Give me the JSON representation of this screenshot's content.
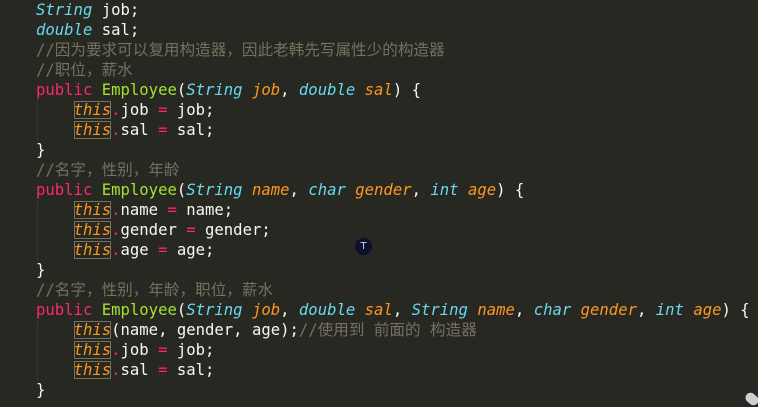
{
  "colors": {
    "background": "#282823",
    "keyword": "#f92672",
    "type": "#66d9ef",
    "function": "#a6e22e",
    "parameter": "#fd971f",
    "comment": "#75715e",
    "text": "#f8f8f2"
  },
  "lines": [
    [
      [
        "type",
        "String"
      ],
      [
        "plain",
        " job;"
      ]
    ],
    [
      [
        "type",
        "double"
      ],
      [
        "plain",
        " sal;"
      ]
    ],
    [
      [
        "comment",
        "//因为要求可以复用构造器，因此老韩先写属性少的构造器"
      ]
    ],
    [
      [
        "comment",
        "//职位，薪水"
      ]
    ],
    [
      [
        "kw",
        "public"
      ],
      [
        "plain",
        " "
      ],
      [
        "fn",
        "Employee"
      ],
      [
        "plain",
        "("
      ],
      [
        "type",
        "String"
      ],
      [
        "plain",
        " "
      ],
      [
        "param",
        "job"
      ],
      [
        "plain",
        ", "
      ],
      [
        "type",
        "double"
      ],
      [
        "plain",
        " "
      ],
      [
        "param",
        "sal"
      ],
      [
        "plain",
        ") {"
      ]
    ],
    [
      [
        "plain",
        "    "
      ],
      [
        "this",
        "this"
      ],
      [
        "op",
        "."
      ],
      [
        "plain",
        "job "
      ],
      [
        "op",
        "="
      ],
      [
        "plain",
        " job;"
      ]
    ],
    [
      [
        "plain",
        "    "
      ],
      [
        "this",
        "this"
      ],
      [
        "op",
        "."
      ],
      [
        "plain",
        "sal "
      ],
      [
        "op",
        "="
      ],
      [
        "plain",
        " sal;"
      ]
    ],
    [
      [
        "plain",
        "}"
      ]
    ],
    [
      [
        "comment",
        "//名字，性别，年龄"
      ]
    ],
    [
      [
        "kw",
        "public"
      ],
      [
        "plain",
        " "
      ],
      [
        "fn",
        "Employee"
      ],
      [
        "plain",
        "("
      ],
      [
        "type",
        "String"
      ],
      [
        "plain",
        " "
      ],
      [
        "param",
        "name"
      ],
      [
        "plain",
        ", "
      ],
      [
        "type",
        "char"
      ],
      [
        "plain",
        " "
      ],
      [
        "param",
        "gender"
      ],
      [
        "plain",
        ", "
      ],
      [
        "type",
        "int"
      ],
      [
        "plain",
        " "
      ],
      [
        "param",
        "age"
      ],
      [
        "plain",
        ") {"
      ]
    ],
    [
      [
        "plain",
        "    "
      ],
      [
        "this",
        "this"
      ],
      [
        "op",
        "."
      ],
      [
        "plain",
        "name "
      ],
      [
        "op",
        "="
      ],
      [
        "plain",
        " name;"
      ]
    ],
    [
      [
        "plain",
        "    "
      ],
      [
        "this",
        "this"
      ],
      [
        "op",
        "."
      ],
      [
        "plain",
        "gender "
      ],
      [
        "op",
        "="
      ],
      [
        "plain",
        " gender;"
      ]
    ],
    [
      [
        "plain",
        "    "
      ],
      [
        "this",
        "this"
      ],
      [
        "op",
        "."
      ],
      [
        "plain",
        "age "
      ],
      [
        "op",
        "="
      ],
      [
        "plain",
        " age;"
      ]
    ],
    [
      [
        "plain",
        "}"
      ]
    ],
    [
      [
        "comment",
        "//名字，性别，年龄，职位，薪水"
      ]
    ],
    [
      [
        "kw",
        "public"
      ],
      [
        "plain",
        " "
      ],
      [
        "fn",
        "Employee"
      ],
      [
        "plain",
        "("
      ],
      [
        "type",
        "String"
      ],
      [
        "plain",
        " "
      ],
      [
        "param",
        "job"
      ],
      [
        "plain",
        ", "
      ],
      [
        "type",
        "double"
      ],
      [
        "plain",
        " "
      ],
      [
        "param",
        "sal"
      ],
      [
        "plain",
        ", "
      ],
      [
        "type",
        "String"
      ],
      [
        "plain",
        " "
      ],
      [
        "param",
        "name"
      ],
      [
        "plain",
        ", "
      ],
      [
        "type",
        "char"
      ],
      [
        "plain",
        " "
      ],
      [
        "param",
        "gender"
      ],
      [
        "plain",
        ", "
      ],
      [
        "type",
        "int"
      ],
      [
        "plain",
        " "
      ],
      [
        "param",
        "age"
      ],
      [
        "plain",
        ") {"
      ]
    ],
    [
      [
        "plain",
        "    "
      ],
      [
        "this",
        "this"
      ],
      [
        "plain",
        "(name, gender, age);"
      ],
      [
        "comment",
        "//使用到 前面的 构造器"
      ]
    ],
    [
      [
        "plain",
        "    "
      ],
      [
        "this",
        "this"
      ],
      [
        "op",
        "."
      ],
      [
        "plain",
        "job "
      ],
      [
        "op",
        "="
      ],
      [
        "plain",
        " job;"
      ]
    ],
    [
      [
        "plain",
        "    "
      ],
      [
        "this",
        "this"
      ],
      [
        "op",
        "."
      ],
      [
        "plain",
        "sal "
      ],
      [
        "op",
        "="
      ],
      [
        "plain",
        " sal;"
      ]
    ],
    [
      [
        "plain",
        "}"
      ]
    ]
  ],
  "cursor_icon": "text-cursor-icon",
  "cursor_label": "T"
}
